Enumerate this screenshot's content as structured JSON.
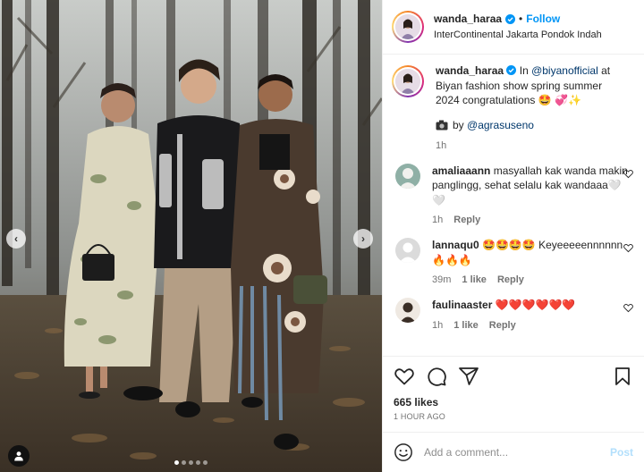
{
  "colors": {
    "accent": "#0095f6",
    "mention": "#00376b",
    "muted": "#737373",
    "border": "#efefef",
    "heart_red": "#ed4956"
  },
  "header": {
    "username": "wanda_haraa",
    "separator": "•",
    "follow_label": "Follow",
    "location": "InterContinental Jakarta Pondok Indah"
  },
  "caption": {
    "username": "wanda_haraa",
    "prefix": "In ",
    "mention": "@biyanofficial",
    "rest": " at Biyan fashion show spring summer 2024 congratulations 🤩 💞✨",
    "credit_by": "by ",
    "credit_mention": "@agrasuseno",
    "time": "1h"
  },
  "comments": [
    {
      "username": "amaliaaann",
      "text": "masyallah kak wanda makin panglingg, sehat selalu kak wandaaa🤍🤍",
      "time": "1h",
      "likes": "",
      "reply": "Reply"
    },
    {
      "username": "lannaqu0",
      "text": "🤩🤩🤩🤩 Keyeeeeennnnnn🔥🔥🔥",
      "time": "39m",
      "likes": "1 like",
      "reply": "Reply"
    },
    {
      "username": "faulinaaster",
      "text": "❤️❤️❤️❤️❤️❤️",
      "time": "1h",
      "likes": "1 like",
      "reply": "Reply"
    }
  ],
  "likes_count": "665 likes",
  "time_ago": "1 HOUR AGO",
  "add_comment": {
    "placeholder": "Add a comment...",
    "post_label": "Post"
  },
  "icons": [
    "chevron-left-icon",
    "chevron-right-icon",
    "user-tag-icon",
    "verified-badge-icon",
    "camera-icon",
    "heart-icon",
    "comment-icon",
    "share-icon",
    "bookmark-icon",
    "emoji-icon"
  ],
  "carousel": {
    "slides": 5,
    "active": 0
  }
}
